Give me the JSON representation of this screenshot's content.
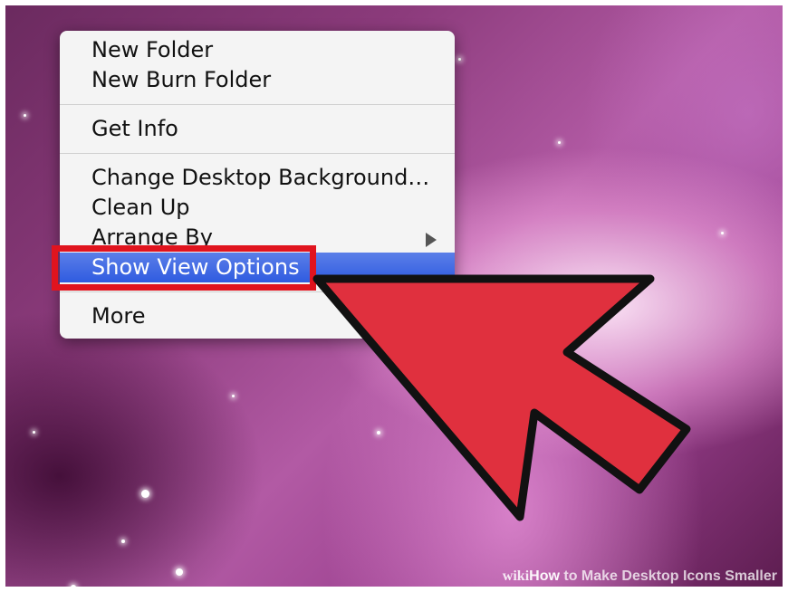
{
  "context_menu": {
    "items": [
      {
        "label": "New Folder"
      },
      {
        "label": "New Burn Folder"
      },
      {
        "label": "Get Info"
      },
      {
        "label": "Change Desktop Background…"
      },
      {
        "label": "Clean Up"
      },
      {
        "label": "Arrange By"
      },
      {
        "label": "Show View Options",
        "selected": true
      },
      {
        "label": "More"
      }
    ]
  },
  "watermark": {
    "brand": "wiki",
    "how": "How",
    "title": " to Make Desktop Icons Smaller"
  },
  "colors": {
    "highlight_box": "#e0141e",
    "arrow_fill": "#e0303e",
    "selection": "#3a62e2"
  },
  "icons": {
    "submenu": "submenu-arrow-icon",
    "pointer": "red-arrow-icon"
  }
}
